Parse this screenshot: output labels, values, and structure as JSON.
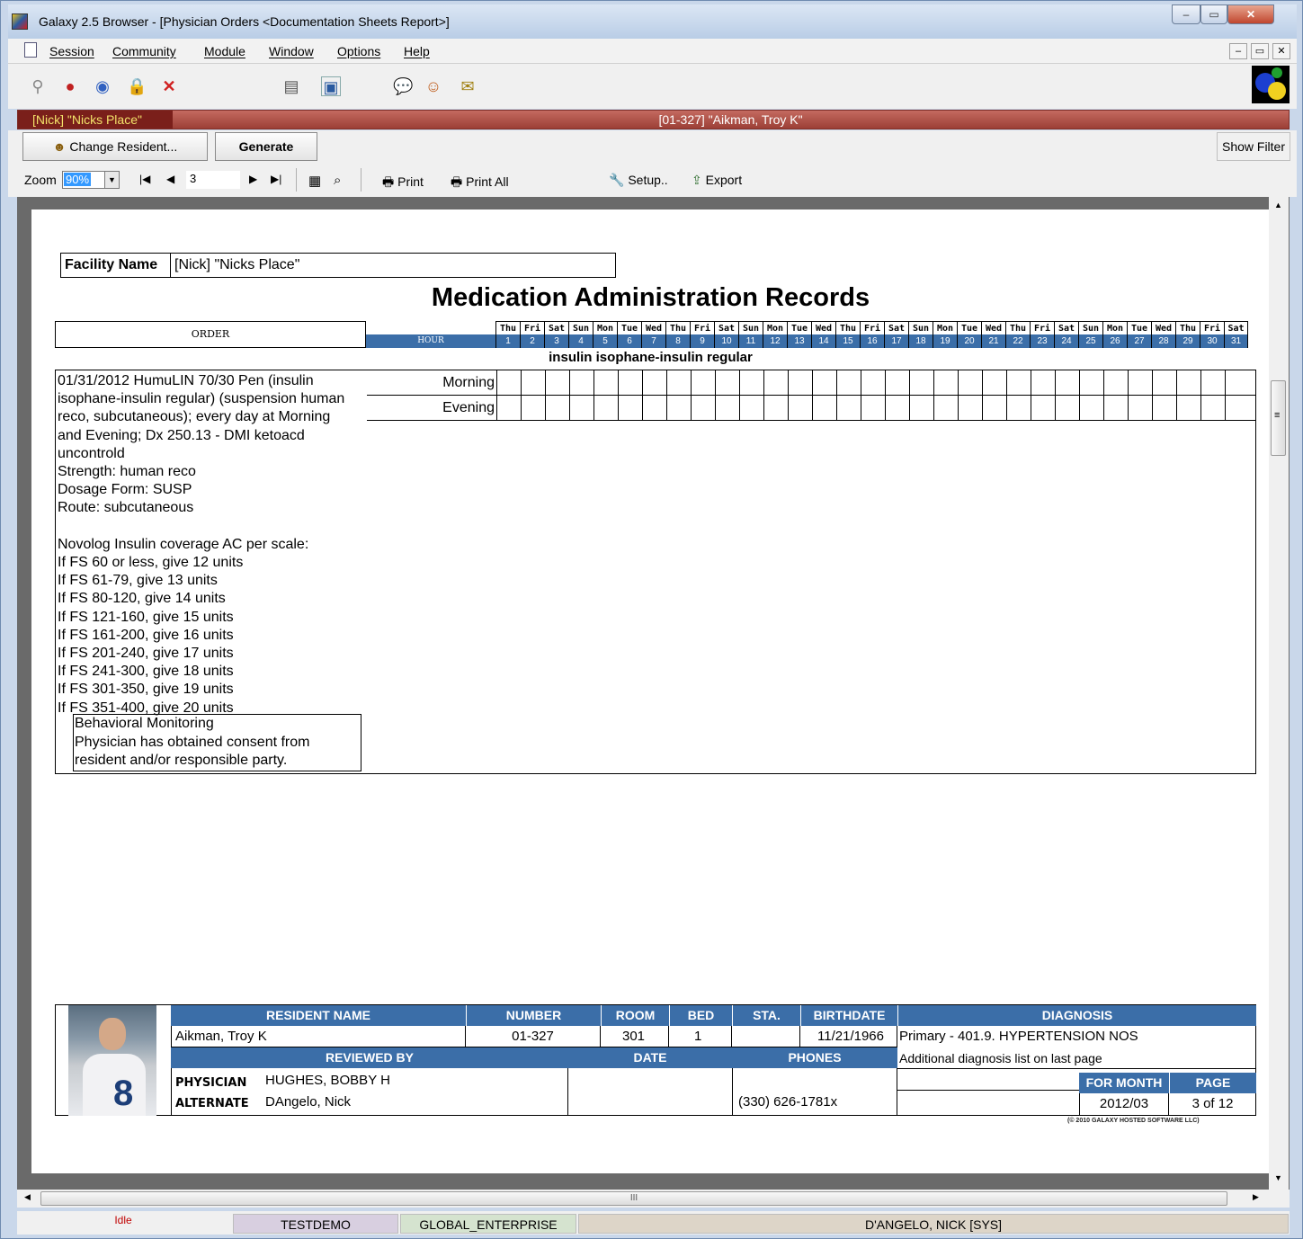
{
  "window": {
    "title": "Galaxy 2.5 Browser - [Physician Orders  <Documentation Sheets Report>]",
    "min": "–",
    "max": "▭",
    "close": "✕"
  },
  "menu": [
    "Session",
    "Community",
    "Module",
    "Window",
    "Options",
    "Help"
  ],
  "context": {
    "facility": "[Nick] \"Nicks Place\"",
    "resident": "[01-327] \"Aikman, Troy K\""
  },
  "actions": {
    "change_resident": "Change Resident...",
    "generate": "Generate",
    "show_filter": "Show Filter"
  },
  "nav": {
    "zoom_label": "Zoom",
    "zoom_value": "90%",
    "page": "3",
    "print": "Print",
    "print_all": "Print All",
    "setup": "Setup..",
    "export": "Export"
  },
  "report": {
    "facility_label": "Facility Name",
    "facility_value": "[Nick] \"Nicks Place\"",
    "title": "Medication Administration Records",
    "order_header": "ORDER",
    "hour_header": "HOUR",
    "days": [
      {
        "w": "Thu",
        "n": "1"
      },
      {
        "w": "Fri",
        "n": "2"
      },
      {
        "w": "Sat",
        "n": "3"
      },
      {
        "w": "Sun",
        "n": "4"
      },
      {
        "w": "Mon",
        "n": "5"
      },
      {
        "w": "Tue",
        "n": "6"
      },
      {
        "w": "Wed",
        "n": "7"
      },
      {
        "w": "Thu",
        "n": "8"
      },
      {
        "w": "Fri",
        "n": "9"
      },
      {
        "w": "Sat",
        "n": "10"
      },
      {
        "w": "Sun",
        "n": "11"
      },
      {
        "w": "Mon",
        "n": "12"
      },
      {
        "w": "Tue",
        "n": "13"
      },
      {
        "w": "Wed",
        "n": "14"
      },
      {
        "w": "Thu",
        "n": "15"
      },
      {
        "w": "Fri",
        "n": "16"
      },
      {
        "w": "Sat",
        "n": "17"
      },
      {
        "w": "Sun",
        "n": "18"
      },
      {
        "w": "Mon",
        "n": "19"
      },
      {
        "w": "Tue",
        "n": "20"
      },
      {
        "w": "Wed",
        "n": "21"
      },
      {
        "w": "Thu",
        "n": "22"
      },
      {
        "w": "Fri",
        "n": "23"
      },
      {
        "w": "Sat",
        "n": "24"
      },
      {
        "w": "Sun",
        "n": "25"
      },
      {
        "w": "Mon",
        "n": "26"
      },
      {
        "w": "Tue",
        "n": "27"
      },
      {
        "w": "Wed",
        "n": "28"
      },
      {
        "w": "Thu",
        "n": "29"
      },
      {
        "w": "Fri",
        "n": "30"
      },
      {
        "w": "Sat",
        "n": "31"
      }
    ],
    "drug_name": "insulin isophane-insulin regular",
    "order_text": "01/31/2012 HumuLIN 70/30 Pen (insulin isophane-insulin regular) (suspension human reco, subcutaneous); every day at Morning and Evening; Dx 250.13 - DMI ketoacd uncontrold\nStrength: human reco\nDosage Form: SUSP\nRoute: subcutaneous\n\nNovolog Insulin coverage AC per scale:\nIf FS 60 or less, give 12 units\nIf FS 61-79, give 13 units\nIf FS 80-120, give 14 units\nIf FS 121-160, give 15 units\nIf FS 161-200, give 16 units\nIf FS 201-240, give 17 units\nIf FS 241-300, give 18 units\nIf FS 301-350, give 19 units\nIf FS 351-400, give 20 units",
    "times": [
      "Morning",
      "Evening"
    ],
    "behavioral": "Behavioral Monitoring\nPhysician has obtained consent from resident and/or responsible party."
  },
  "footer": {
    "h_name": "RESIDENT NAME",
    "h_number": "NUMBER",
    "h_room": "ROOM",
    "h_bed": "BED",
    "h_sta": "STA.",
    "h_birth": "BIRTHDATE",
    "h_diag": "DIAGNOSIS",
    "name": "Aikman, Troy K",
    "number": "01-327",
    "room": "301",
    "bed": "1",
    "sta": "",
    "birthdate": "11/21/1966",
    "diag1": "Primary - 401.9. HYPERTENSION NOS",
    "diag2": "Additional diagnosis list on last page",
    "h_reviewed": "REVIEWED BY",
    "h_date": "DATE",
    "h_phones": "PHONES",
    "physician_label": "PHYSICIAN",
    "physician": "HUGHES, BOBBY H",
    "alternate_label": "ALTERNATE",
    "alternate": "DAngelo, Nick",
    "phone": "(330) 626-1781x",
    "h_month": "FOR MONTH",
    "h_page": "PAGE",
    "month": "2012/03",
    "page": "3 of 12",
    "copyright": "(© 2010 GALAXY HOSTED SOFTWARE LLC)"
  },
  "status": {
    "state": "Idle",
    "db": "TESTDEMO",
    "enterprise": "GLOBAL_ENTERPRISE",
    "user": "D'ANGELO, NICK [SYS]"
  },
  "scroll": {
    "h_grip": "III",
    "v_grip": "≡"
  },
  "colors": {
    "accent": "#3b6ea8",
    "context_bar": "#9c3f36",
    "facility_text": "#f3e26a"
  }
}
